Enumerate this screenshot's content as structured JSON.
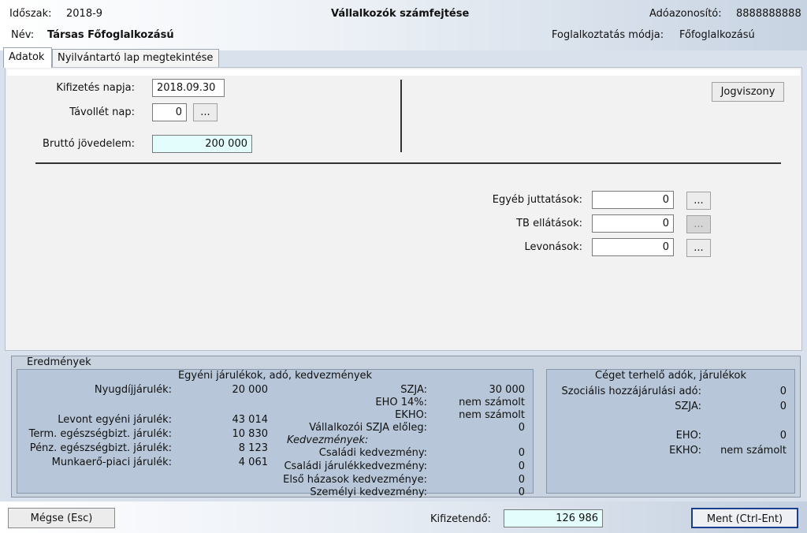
{
  "header": {
    "period_label": "Időszak:",
    "period_value": "2018-9",
    "title": "Vállalkozók számfejtése",
    "taxid_label": "Adóazonosító:",
    "taxid_value": "8888888888",
    "name_label": "Név:",
    "name_value": "Társas Főfoglalkozású",
    "employment_label": "Foglalkoztatás módja:",
    "employment_value": "Főfoglalkozású"
  },
  "tabs": [
    {
      "label": "Adatok",
      "active": true
    },
    {
      "label": "Nyilvántartó lap megtekintése",
      "active": false
    }
  ],
  "form": {
    "payment_date_label": "Kifizetés napja:",
    "payment_date_value": "2018.09.30",
    "absence_label": "Távollét nap:",
    "absence_value": "0",
    "ellipsis": "...",
    "gross_label": "Bruttó jövedelem:",
    "gross_value": "200 000",
    "jogviszony_label": "Jogviszony",
    "other_benefits_label": "Egyéb juttatások:",
    "other_benefits_value": "0",
    "tb_label": "TB ellátások:",
    "tb_value": "0",
    "deductions_label": "Levonások:",
    "deductions_value": "0"
  },
  "results": {
    "legend": "Eredmények",
    "individual": {
      "title": "Egyéni járulékok, adó, kedvezmények",
      "left_rows": [
        {
          "label": "Nyugdíjjárulék:",
          "value": "20 000"
        },
        {
          "label": "Levont egyéni járulék:",
          "value": "43 014"
        },
        {
          "label": "Term. egészségbizt. járulék:",
          "value": "10 830"
        },
        {
          "label": "Pénz. egészségbizt. járulék:",
          "value": "8 123"
        },
        {
          "label": "Munkaerő-piaci járulék:",
          "value": "4 061"
        }
      ],
      "right_rows": [
        {
          "label": "SZJA:",
          "value": "30 000"
        },
        {
          "label": "EHO 14%:",
          "value": "nem számolt"
        },
        {
          "label": "EKHO:",
          "value": "nem számolt"
        },
        {
          "label": "Vállalkozói SZJA előleg:",
          "value": "0"
        }
      ],
      "discounts_heading": "Kedvezmények:",
      "discount_rows": [
        {
          "label": "Családi kedvezmény:",
          "value": "0"
        },
        {
          "label": "Családi járulékkedvezmény:",
          "value": "0"
        },
        {
          "label": "Első házasok kedvezménye:",
          "value": "0"
        },
        {
          "label": "Személyi kedvezmény:",
          "value": "0"
        }
      ]
    },
    "company": {
      "title": "Céget terhelő adók, járulékok",
      "rows": [
        {
          "label": "Szociális hozzájárulási adó:",
          "value": "0"
        },
        {
          "label": "SZJA:",
          "value": "0"
        },
        {
          "label": "EHO:",
          "value": "0"
        },
        {
          "label": "EKHO:",
          "value": "nem számolt"
        }
      ]
    }
  },
  "footer": {
    "cancel_label": "Mégse (Esc)",
    "payable_label": "Kifizetendő:",
    "payable_value": "126 986",
    "save_label": "Ment (Ctrl-Ent)"
  }
}
